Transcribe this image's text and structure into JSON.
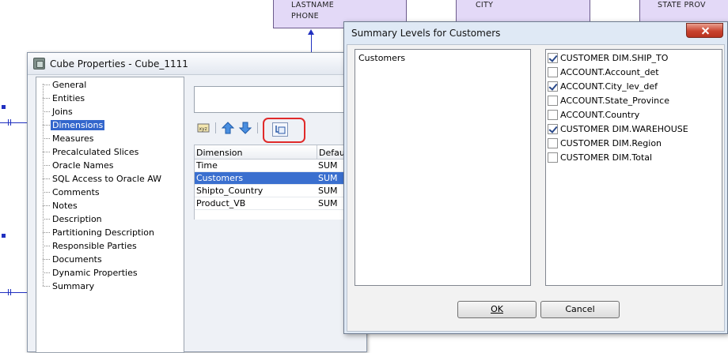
{
  "diagram": {
    "entities": [
      {
        "lines": [
          "LASTNAME",
          "PHONE"
        ]
      },
      {
        "lines": [
          "CITY"
        ]
      },
      {
        "lines": [
          "STATE PROV"
        ]
      }
    ]
  },
  "cube_window": {
    "title": "Cube Properties - Cube_1111",
    "nav_items": [
      "General",
      "Entities",
      "Joins",
      "Dimensions",
      "Measures",
      "Precalculated Slices",
      "Oracle Names",
      "SQL Access to Oracle AW",
      "Comments",
      "Notes",
      "Description",
      "Partitioning Description",
      "Responsible Parties",
      "Documents",
      "Dynamic Properties",
      "Summary"
    ],
    "selected_nav": "Dimensions",
    "table": {
      "headers": [
        "Dimension",
        "Default"
      ],
      "rows": [
        {
          "dimension": "Time",
          "default": "SUM"
        },
        {
          "dimension": "Customers",
          "default": "SUM"
        },
        {
          "dimension": "Shipto_Country",
          "default": "SUM"
        },
        {
          "dimension": "Product_VB",
          "default": "SUM"
        }
      ],
      "selected_row": "Customers"
    },
    "toolbar_icons": [
      "expression-icon",
      "move-up-icon",
      "move-down-icon",
      "summary-levels-icon"
    ]
  },
  "summary_dialog": {
    "title": "Summary Levels for Customers",
    "left_list": [
      "Customers"
    ],
    "levels": [
      {
        "label": "CUSTOMER DIM.SHIP_TO",
        "checked": true
      },
      {
        "label": "ACCOUNT.Account_det",
        "checked": false
      },
      {
        "label": "ACCOUNT.City_lev_def",
        "checked": true
      },
      {
        "label": "ACCOUNT.State_Province",
        "checked": false
      },
      {
        "label": "ACCOUNT.Country",
        "checked": false
      },
      {
        "label": "CUSTOMER DIM.WAREHOUSE",
        "checked": true
      },
      {
        "label": "CUSTOMER DIM.Region",
        "checked": false
      },
      {
        "label": "CUSTOMER DIM.Total",
        "checked": false
      }
    ],
    "ok_label": "OK",
    "cancel_label": "Cancel"
  },
  "colors": {
    "selection": "#3366cc",
    "highlight_ring": "#e02a2a",
    "entity_fill": "#e3d9f7",
    "connector": "#2030c0"
  }
}
